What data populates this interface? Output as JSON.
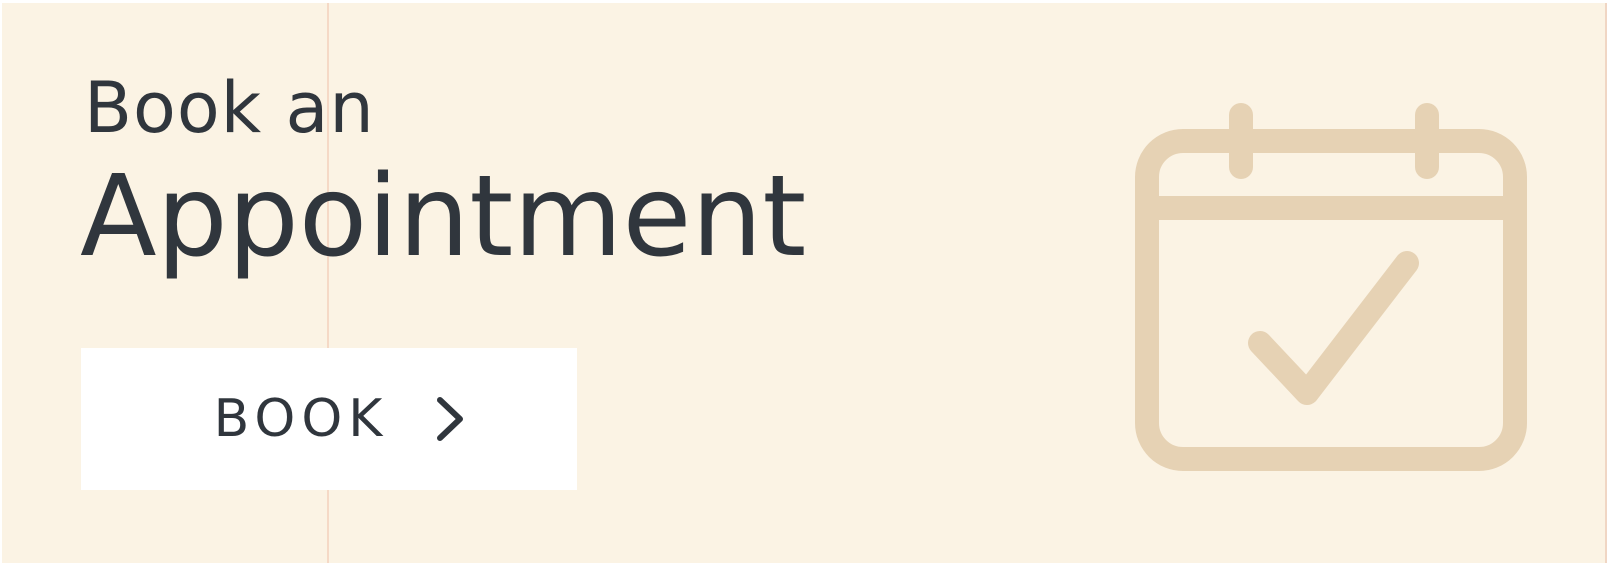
{
  "banner": {
    "heading_line1": "Book an",
    "heading_line2": "Appointment",
    "button_label": "BOOK",
    "button_icon": "chevron-right-icon",
    "illustration_icon": "calendar-check-icon"
  },
  "colors": {
    "background": "#fbf3e4",
    "text": "#30363d",
    "button_bg": "#ffffff",
    "icon": "#e6d2b4"
  }
}
